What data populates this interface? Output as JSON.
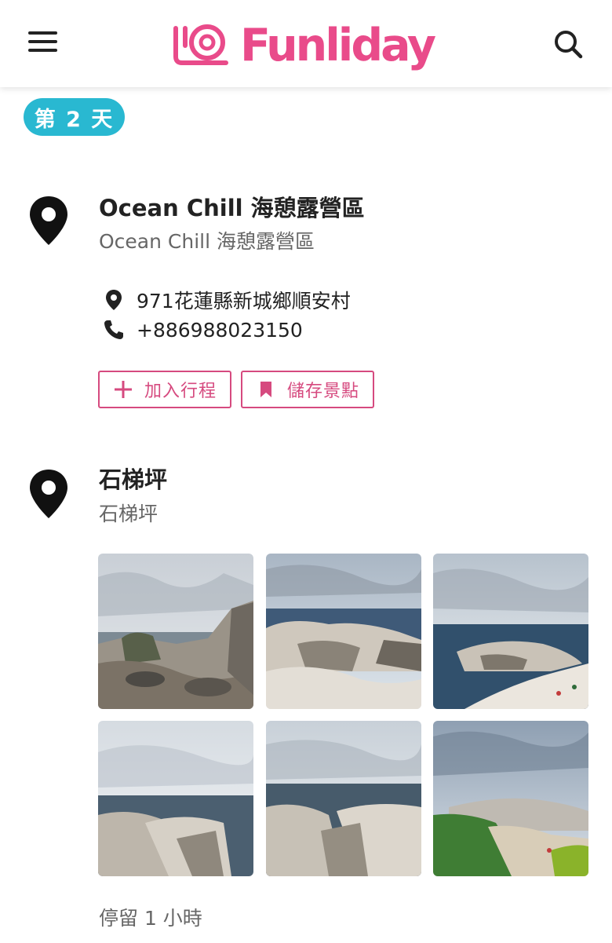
{
  "header": {
    "logo_text": "Funliday",
    "brand_color": "#e94b8a"
  },
  "day_badge": "第 2 天",
  "places": [
    {
      "title": "Ocean Chill 海憩露營區",
      "subtitle": "Ocean Chill 海憩露營區",
      "address": "971花蓮縣新城鄉順安村",
      "phone": "+886988023150",
      "add_button": "加入行程",
      "save_button": "儲存景點"
    },
    {
      "title": "石梯坪",
      "subtitle": "石梯坪",
      "stay": "停留 1 小時"
    }
  ],
  "icons": {
    "menu": "menu-icon",
    "search": "search-icon",
    "pin": "map-pin-icon",
    "location": "location-icon",
    "phone": "phone-icon",
    "plus": "plus-icon",
    "bookmark": "bookmark-icon"
  },
  "colors": {
    "badge": "#29b8d1",
    "accent": "#d64a7f"
  }
}
